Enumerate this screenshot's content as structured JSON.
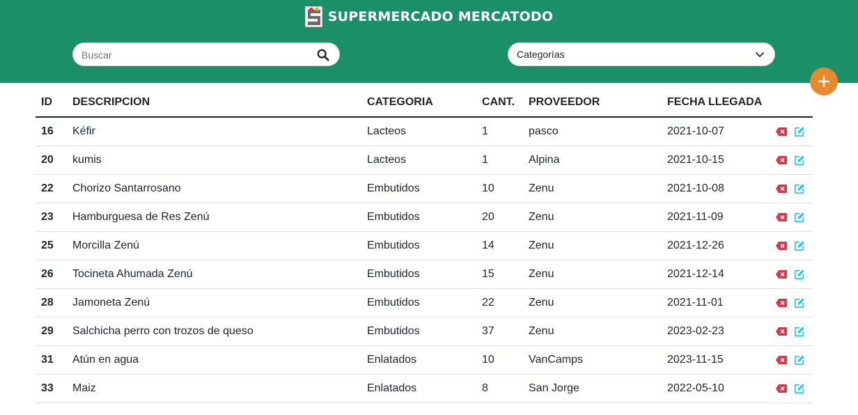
{
  "header": {
    "title": "SUPERMERCADO MERCATODO",
    "logo_icon": "store-logo-icon",
    "background": "#1b9068"
  },
  "search": {
    "placeholder": "Buscar",
    "icon": "search-icon"
  },
  "category_select": {
    "label": "Categorías",
    "icon": "chevron-down-icon"
  },
  "add_button": {
    "icon": "plus-icon",
    "color": "#e8892b"
  },
  "table": {
    "headers": {
      "id": "ID",
      "description": "DESCRIPCION",
      "category": "CATEGORIA",
      "quantity": "CANT.",
      "provider": "PROVEEDOR",
      "arrival_date": "FECHA LLEGADA"
    },
    "rows": [
      {
        "id": "16",
        "description": "Kéfir",
        "category": "Lacteos",
        "quantity": "1",
        "provider": "pasco",
        "date": "2021-10-07"
      },
      {
        "id": "20",
        "description": "kumis",
        "category": "Lacteos",
        "quantity": "1",
        "provider": "Alpina",
        "date": "2021-10-15"
      },
      {
        "id": "22",
        "description": "Chorizo Santarrosano",
        "category": "Embutidos",
        "quantity": "10",
        "provider": "Zenu",
        "date": "2021-10-08"
      },
      {
        "id": "23",
        "description": "Hamburguesa de Res Zenú",
        "category": "Embutidos",
        "quantity": "20",
        "provider": "Zenu",
        "date": "2021-11-09"
      },
      {
        "id": "25",
        "description": "Morcilla Zenú",
        "category": "Embutidos",
        "quantity": "14",
        "provider": "Zenu",
        "date": "2021-12-26"
      },
      {
        "id": "26",
        "description": "Tocineta Ahumada Zenú",
        "category": "Embutidos",
        "quantity": "15",
        "provider": "Zenu",
        "date": "2021-12-14"
      },
      {
        "id": "28",
        "description": "Jamoneta Zenú",
        "category": "Embutidos",
        "quantity": "22",
        "provider": "Zenu",
        "date": "2021-11-01"
      },
      {
        "id": "29",
        "description": "Salchicha perro con trozos de queso",
        "category": "Embutidos",
        "quantity": "37",
        "provider": "Zenu",
        "date": "2023-02-23"
      },
      {
        "id": "31",
        "description": "Atún en agua",
        "category": "Enlatados",
        "quantity": "10",
        "provider": "VanCamps",
        "date": "2023-11-15"
      },
      {
        "id": "33",
        "description": "Maiz",
        "category": "Enlatados",
        "quantity": "8",
        "provider": "San Jorge",
        "date": "2022-05-10"
      }
    ],
    "action_icons": {
      "delete": "delete-icon",
      "edit": "edit-icon"
    },
    "colors": {
      "delete": "#dc3545",
      "edit": "#0dcaf0"
    }
  }
}
